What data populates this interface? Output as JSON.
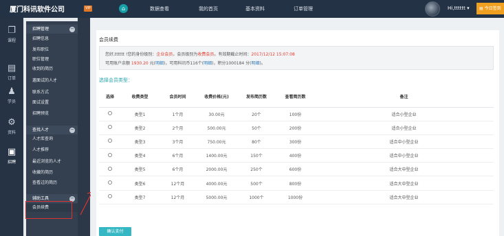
{
  "header": {
    "logo": "厦门科讯软件公司",
    "vip_badge": "VIP",
    "home_icon": "home-icon",
    "nav": [
      "数据查看",
      "我的首页",
      "基本资料",
      "订单管理"
    ],
    "username": "Hi,tttttt ▾",
    "right_button": "今日签到"
  },
  "icon_sidebar": [
    {
      "icon": "book-icon",
      "glyph": "📖",
      "label": "课程"
    },
    {
      "icon": "order-icon",
      "glyph": "📄",
      "label": "订单"
    },
    {
      "icon": "student-icon",
      "glyph": "👥",
      "label": "学员"
    },
    {
      "icon": "settings-icon",
      "glyph": "⚙",
      "label": "资料"
    },
    {
      "icon": "recruit-icon",
      "glyph": "📋",
      "label": "招聘"
    }
  ],
  "submenu": {
    "groups": [
      {
        "title": "招聘管理",
        "items": [
          "招聘信息",
          "发布职位",
          "职位管理",
          "收到的简历",
          "邀面试的人才",
          "联系方式",
          "面试设置",
          "招聘预览"
        ]
      },
      {
        "title": "查找人才",
        "items": [
          "人才库查询",
          "人才推荐",
          "最近浏览的人才",
          "收藏的简历",
          "查看过的简历"
        ]
      },
      {
        "title": "辅助工具",
        "items": [
          "会员续费"
        ]
      }
    ]
  },
  "main": {
    "section_title": "会员续费",
    "info": {
      "line1_a": "您好,tttttt !您的身份级别：",
      "level": "企业会员",
      "line1_b": "，会员级别为",
      "member_type": "收费会员",
      "line1_c": "。有效期截止时间：",
      "expiry": "2017/12/12 15:07:08",
      "line2_a": "可用账户余额 ",
      "balance": "1930.20",
      "line2_b": " 元(",
      "detail1": "明细",
      "line2_c": ")，可用科讯币116个(",
      "detail2": "明细",
      "line2_d": ")，积分1000184 分(",
      "detail3": "明细",
      "line2_e": ")。"
    },
    "select_title": "选择会员类型：",
    "table": {
      "headers": [
        "选择",
        "收费类型",
        "会员时间",
        "收费价格(元)",
        "发布简历数",
        "查看简历数",
        "备注"
      ],
      "rows": [
        [
          "类型1",
          "1个月",
          "30.00元",
          "20个",
          "100份",
          "适合小型企业"
        ],
        [
          "类型2",
          "2个月",
          "500.00元",
          "50个",
          "200份",
          "适合小型企业"
        ],
        [
          "类型3",
          "3个月",
          "750.00元",
          "80个",
          "300份",
          "适合中小型企业"
        ],
        [
          "类型4",
          "6个月",
          "1400.00元",
          "150个",
          "400份",
          "适合中小型企业"
        ],
        [
          "类型5",
          "6个月",
          "2000.00元",
          "250个",
          "600份",
          "适合大中型企业"
        ],
        [
          "类型6",
          "12个月",
          "4000.00元",
          "500个",
          "800份",
          "适合大中型企业"
        ],
        [
          "类型7",
          "12个月",
          "5000.00元",
          "1000个",
          "1000份",
          "适合大中型企业"
        ]
      ]
    },
    "confirm_button": "确认支付"
  },
  "colors": {
    "topbar": "#243245",
    "accent": "#35b7c4",
    "highlight": "#e03b2f"
  }
}
